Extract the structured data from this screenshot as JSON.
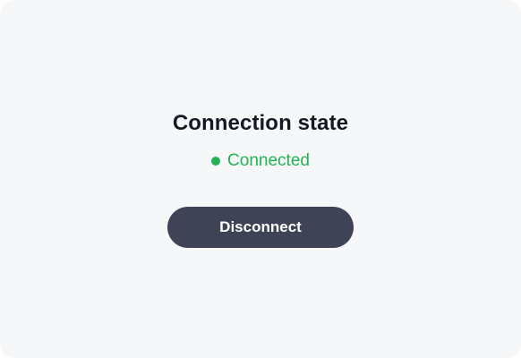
{
  "title": "Connection state",
  "status": {
    "text": "Connected",
    "color": "#21b354",
    "icon": "status-dot-icon"
  },
  "action": {
    "label": "Disconnect",
    "background": "#3e4455"
  },
  "colors": {
    "panel_background": "#f6f7f9",
    "title_text": "#151923"
  }
}
